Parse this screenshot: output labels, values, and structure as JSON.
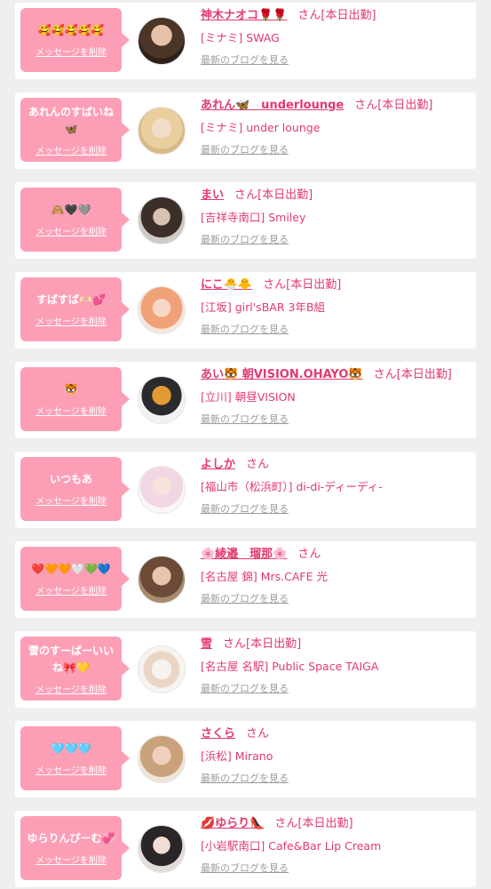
{
  "delete_label": "メッセージを削除",
  "blog_label": "最新のブログを見る",
  "san_label": "さん",
  "today_label": "[本日出勤]",
  "colors": {
    "page_bg": "#efeff1",
    "bubble": "#fc9fb6",
    "accent": "#e23a6e",
    "muted": "#9c9c9c"
  },
  "items": [
    {
      "message": "🥰🥰🥰🥰🥰",
      "name": "神木ナオコ🌹🌹",
      "today": true,
      "shop": "[ミナミ] SWAG"
    },
    {
      "message": "あれんのすぱいね🦋",
      "name": "あれん🦋　underlounge",
      "today": true,
      "shop": "[ミナミ] under lounge"
    },
    {
      "message": "🙈🖤🩶",
      "name": "まい",
      "today": true,
      "shop": "[吉祥寺南口] Smiley"
    },
    {
      "message": "すばすば🫶🏻💕",
      "name": "にこ🐣🐥",
      "today": true,
      "shop": "[江坂] girl'sBAR 3年B組"
    },
    {
      "message": "🐯",
      "name": "あい🐯 朝VISION.OHAYO🐯",
      "today": true,
      "shop": "[立川] 朝昼VISION"
    },
    {
      "message": "いつもあ",
      "name": "よしか",
      "today": false,
      "shop": "[福山市（松浜町）] di-di-ディーディ-"
    },
    {
      "message": "❤️🧡🧡🤍💚💙",
      "name": "🌸綾邉　瑠那🌸",
      "today": false,
      "shop": "[名古屋 錦] Mrs.CAFE 光"
    },
    {
      "message": "雪のすーぱーいいね🎀💛",
      "name": "雪",
      "today": true,
      "shop": "[名古屋 名駅] Public Space TAIGA"
    },
    {
      "message": "🩵🩵🩵",
      "name": "さくら",
      "today": false,
      "shop": "[浜松] Mirano"
    },
    {
      "message": "ゆらりんぴーむ💞",
      "name": "💋ゆらり👠",
      "today": true,
      "shop": "[小岩駅南口] Cafe&Bar Lip Cream"
    }
  ]
}
